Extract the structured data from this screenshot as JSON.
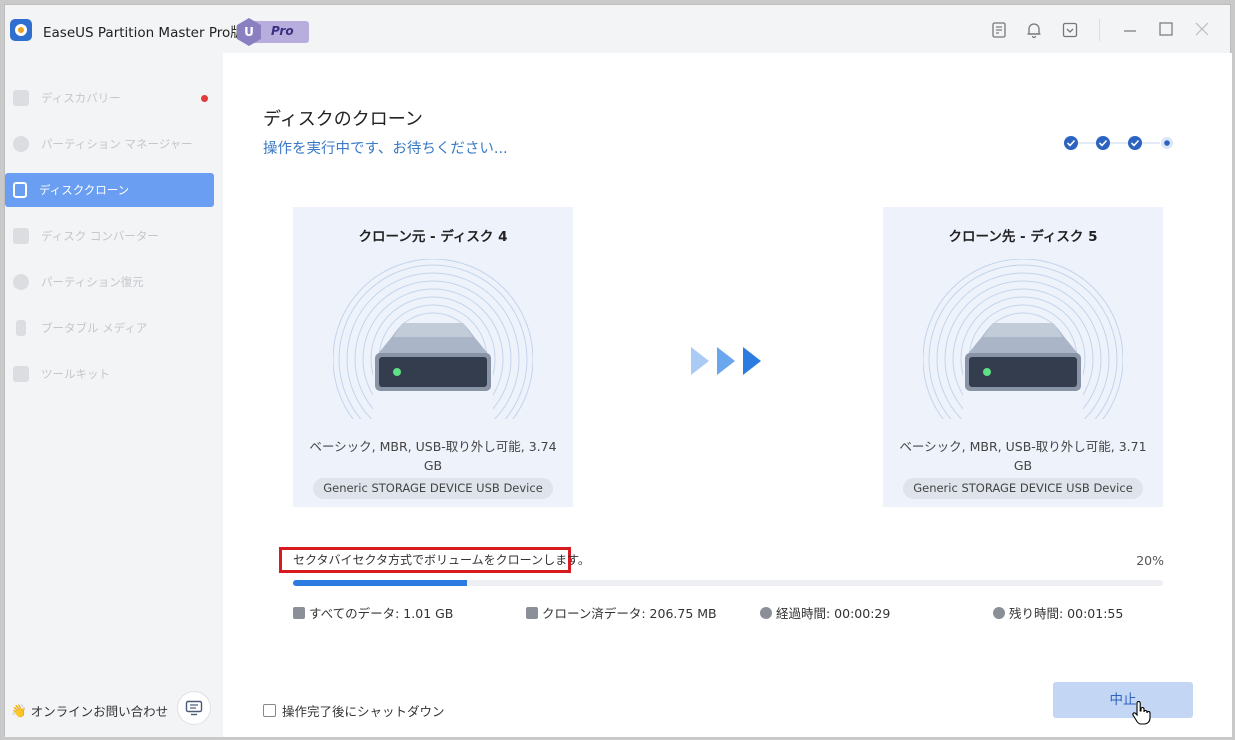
{
  "titlebar": {
    "app_title": "EaseUS Partition Master Pro版",
    "badge_letter": "U",
    "badge_text": "Pro",
    "icons": [
      "notes-icon",
      "bell-icon",
      "dropdown-box-icon"
    ],
    "window_controls": [
      "minimize",
      "maximize",
      "close"
    ]
  },
  "sidebar": {
    "items": [
      {
        "label": "ディスカバリー",
        "icon": "discovery-icon",
        "active": false,
        "dot": true
      },
      {
        "label": "パーティション マネージャー",
        "icon": "pie-chart-icon",
        "active": false,
        "dot": false
      },
      {
        "label": "ディスククローン",
        "icon": "disk-clone-icon",
        "active": true,
        "dot": false
      },
      {
        "label": "ディスク コンバーター",
        "icon": "converter-icon",
        "active": false,
        "dot": false
      },
      {
        "label": "パーティション復元",
        "icon": "recovery-icon",
        "active": false,
        "dot": false
      },
      {
        "label": "ブータブル メディア",
        "icon": "usb-icon",
        "active": false,
        "dot": false
      },
      {
        "label": "ツールキット",
        "icon": "toolkit-icon",
        "active": false,
        "dot": false
      }
    ],
    "online_label": "オンラインお問い合わせ",
    "online_emoji": "👋"
  },
  "main": {
    "title": "ディスクのクローン",
    "subtitle": "操作を実行中です、お待ちください...",
    "steps_completed": 3,
    "steps_total": 4,
    "source": {
      "title": "クローン元 - ディスク 4",
      "info": "ベーシック, MBR, USB-取り外し可能, 3.74 GB",
      "device": "Generic  STORAGE DEVICE   USB Device"
    },
    "target": {
      "title": "クローン先 - ディスク 5",
      "info": "ベーシック, MBR, USB-取り外し可能, 3.71 GB",
      "device": "Generic  STORAGE DEVICE   USB Device"
    },
    "status_text": "セクタバイセクタ方式でボリュームをクローンします。",
    "percent_text": "20%",
    "progress_fraction": 0.2,
    "stats": {
      "total": "すべてのデータ: 1.01 GB",
      "cloned": "クローン済データ: 206.75 MB",
      "elapsed": "経過時間: 00:00:29",
      "remaining": "残り時間: 00:01:55"
    },
    "shutdown_label": "操作完了後にシャットダウン",
    "stop_label": "中止"
  },
  "colors": {
    "accent": "#2b7be0",
    "active_nav": "#6a9ef2",
    "highlight_box": "#d71920",
    "card_bg": "#eef3fb",
    "stop_button_bg": "#c3d6f3"
  }
}
